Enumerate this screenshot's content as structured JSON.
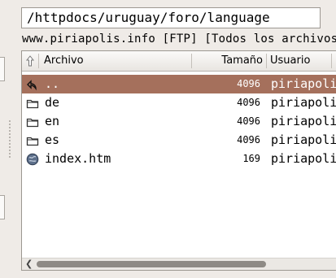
{
  "path_bar": {
    "value": "/httpdocs/uruguay/foro/language"
  },
  "title_line": "www.piriapolis.info [FTP] [Todos los archivos",
  "columns": {
    "up_icon": "up-arrow-icon",
    "name": "Archivo",
    "size": "Tamaño",
    "owner": "Usuario"
  },
  "files": [
    {
      "icon": "parent-dir-icon",
      "name": "..",
      "size": "4096",
      "owner": "piriapolis",
      "selected": true
    },
    {
      "icon": "folder-icon",
      "name": "de",
      "size": "4096",
      "owner": "piriapolis"
    },
    {
      "icon": "folder-icon",
      "name": "en",
      "size": "4096",
      "owner": "piriapolis"
    },
    {
      "icon": "folder-icon",
      "name": "es",
      "size": "4096",
      "owner": "piriapolis"
    },
    {
      "icon": "html-file-icon",
      "name": "index.htm",
      "size": "169",
      "owner": "piriapolis"
    }
  ],
  "colors": {
    "selection": "#a5705c",
    "folder": "#3a3a3a"
  }
}
